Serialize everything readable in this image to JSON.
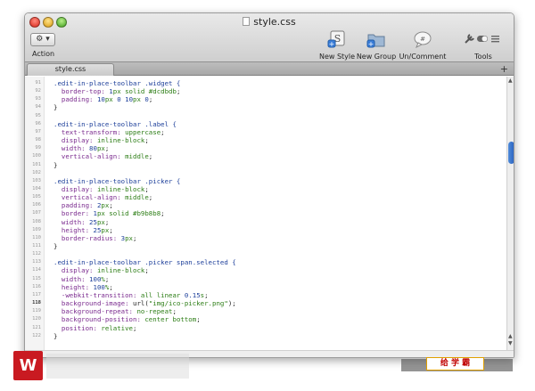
{
  "window": {
    "title": "style.css"
  },
  "toolbar": {
    "action_label": "Action",
    "action_button_glyph": "⚙ ▾",
    "new_style_label": "New Style",
    "new_group_label": "New Group",
    "un_comment_label": "Un/Comment",
    "tools_label": "Tools"
  },
  "tabs": [
    {
      "label": "style.css"
    }
  ],
  "colors": {
    "selector": "#1d3f9a",
    "property": "#7a2a8e",
    "value": "#2c7d15",
    "scroll_thumb": "#2a62c0"
  },
  "overlay": {
    "brand_text": "给 学 霸"
  },
  "editor": {
    "lines": [
      {
        "n": "91",
        "t": [
          [
            "sel",
            ".edit-in-place-toolbar .widget {"
          ]
        ]
      },
      {
        "n": "92",
        "t": [
          [
            "prop",
            "  border-top: "
          ],
          [
            "num",
            "1"
          ],
          [
            "val",
            "px solid #dcdbdb"
          ],
          [
            "punc",
            ";"
          ]
        ]
      },
      {
        "n": "93",
        "t": [
          [
            "prop",
            "  padding: "
          ],
          [
            "num",
            "10"
          ],
          [
            "val",
            "px "
          ],
          [
            "num",
            "0"
          ],
          [
            "val",
            " "
          ],
          [
            "num",
            "10"
          ],
          [
            "val",
            "px "
          ],
          [
            "num",
            "0"
          ],
          [
            "punc",
            ";"
          ]
        ]
      },
      {
        "n": "94",
        "t": [
          [
            "punc",
            "}"
          ]
        ]
      },
      {
        "n": "95",
        "t": []
      },
      {
        "n": "96",
        "t": [
          [
            "sel",
            ".edit-in-place-toolbar .label {"
          ]
        ]
      },
      {
        "n": "97",
        "t": [
          [
            "prop",
            "  text-transform: "
          ],
          [
            "val",
            "uppercase"
          ],
          [
            "punc",
            ";"
          ]
        ]
      },
      {
        "n": "98",
        "t": [
          [
            "prop",
            "  display: "
          ],
          [
            "val",
            "inline-block"
          ],
          [
            "punc",
            ";"
          ]
        ]
      },
      {
        "n": "99",
        "t": [
          [
            "prop",
            "  width: "
          ],
          [
            "num",
            "80"
          ],
          [
            "val",
            "px"
          ],
          [
            "punc",
            ";"
          ]
        ]
      },
      {
        "n": "100",
        "t": [
          [
            "prop",
            "  vertical-align: "
          ],
          [
            "val",
            "middle"
          ],
          [
            "punc",
            ";"
          ]
        ]
      },
      {
        "n": "101",
        "t": [
          [
            "punc",
            "}"
          ]
        ]
      },
      {
        "n": "102",
        "t": []
      },
      {
        "n": "103",
        "t": [
          [
            "sel",
            ".edit-in-place-toolbar .picker {"
          ]
        ]
      },
      {
        "n": "104",
        "t": [
          [
            "prop",
            "  display: "
          ],
          [
            "val",
            "inline-block"
          ],
          [
            "punc",
            ";"
          ]
        ]
      },
      {
        "n": "105",
        "t": [
          [
            "prop",
            "  vertical-align: "
          ],
          [
            "val",
            "middle"
          ],
          [
            "punc",
            ";"
          ]
        ]
      },
      {
        "n": "106",
        "t": [
          [
            "prop",
            "  padding: "
          ],
          [
            "num",
            "2"
          ],
          [
            "val",
            "px"
          ],
          [
            "punc",
            ";"
          ]
        ]
      },
      {
        "n": "107",
        "t": [
          [
            "prop",
            "  border: "
          ],
          [
            "num",
            "1"
          ],
          [
            "val",
            "px solid #b9b8b8"
          ],
          [
            "punc",
            ";"
          ]
        ]
      },
      {
        "n": "108",
        "t": [
          [
            "prop",
            "  width: "
          ],
          [
            "num",
            "25"
          ],
          [
            "val",
            "px"
          ],
          [
            "punc",
            ";"
          ]
        ]
      },
      {
        "n": "109",
        "t": [
          [
            "prop",
            "  height: "
          ],
          [
            "num",
            "25"
          ],
          [
            "val",
            "px"
          ],
          [
            "punc",
            ";"
          ]
        ]
      },
      {
        "n": "110",
        "t": [
          [
            "prop",
            "  border-radius: "
          ],
          [
            "num",
            "3"
          ],
          [
            "val",
            "px"
          ],
          [
            "punc",
            ";"
          ]
        ]
      },
      {
        "n": "111",
        "t": [
          [
            "punc",
            "}"
          ]
        ]
      },
      {
        "n": "112",
        "t": []
      },
      {
        "n": "113",
        "t": [
          [
            "sel",
            ".edit-in-place-toolbar .picker span.selected {"
          ]
        ]
      },
      {
        "n": "114",
        "t": [
          [
            "prop",
            "  display: "
          ],
          [
            "val",
            "inline-block"
          ],
          [
            "punc",
            ";"
          ]
        ]
      },
      {
        "n": "115",
        "t": [
          [
            "prop",
            "  width: "
          ],
          [
            "num",
            "100"
          ],
          [
            "val",
            "%"
          ],
          [
            "punc",
            ";"
          ]
        ]
      },
      {
        "n": "116",
        "t": [
          [
            "prop",
            "  height: "
          ],
          [
            "num",
            "100"
          ],
          [
            "val",
            "%"
          ],
          [
            "punc",
            ";"
          ]
        ]
      },
      {
        "n": "117",
        "t": [
          [
            "prop",
            "  -webkit-transition: "
          ],
          [
            "val",
            "all linear "
          ],
          [
            "num",
            "0.15"
          ],
          [
            "val",
            "s"
          ],
          [
            "punc",
            ";"
          ]
        ]
      },
      {
        "n": "118",
        "bold": true,
        "t": [
          [
            "prop",
            "  background-image: "
          ],
          [
            "fn",
            "url("
          ],
          [
            "str",
            "\"img/ico-picker.png\""
          ],
          [
            "fn",
            ")"
          ],
          [
            "punc",
            ";"
          ]
        ]
      },
      {
        "n": "119",
        "t": [
          [
            "prop",
            "  background-repeat: "
          ],
          [
            "val",
            "no-repeat"
          ],
          [
            "punc",
            ";"
          ]
        ]
      },
      {
        "n": "120",
        "t": [
          [
            "prop",
            "  background-position: "
          ],
          [
            "val",
            "center bottom"
          ],
          [
            "punc",
            ";"
          ]
        ]
      },
      {
        "n": "121",
        "t": [
          [
            "prop",
            "  position: "
          ],
          [
            "val",
            "relative"
          ],
          [
            "punc",
            ";"
          ]
        ]
      },
      {
        "n": "122",
        "t": [
          [
            "punc",
            "}"
          ]
        ]
      }
    ]
  }
}
